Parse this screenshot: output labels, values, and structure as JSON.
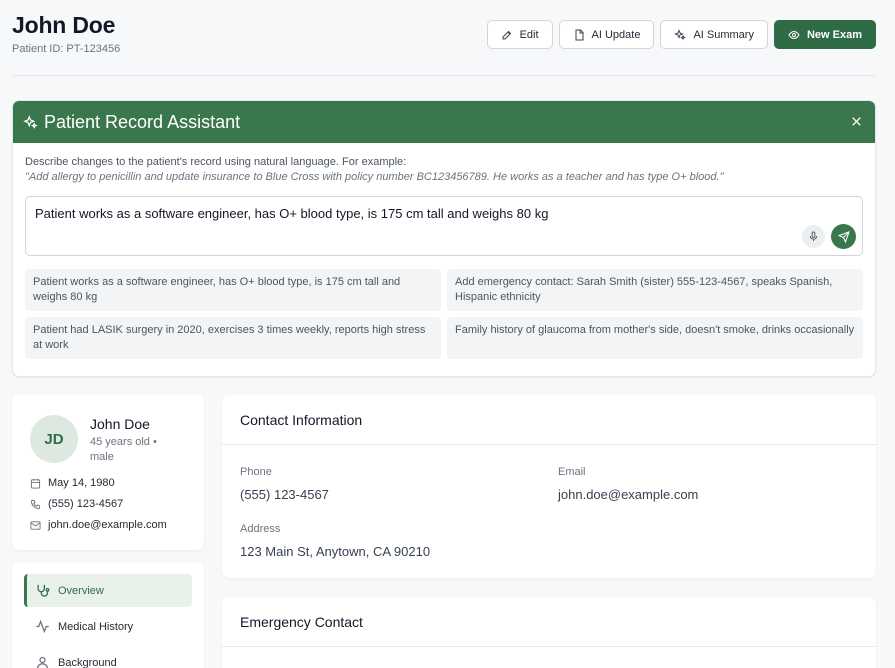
{
  "header": {
    "name": "John Doe",
    "patient_id": "Patient ID: PT-123456",
    "actions": {
      "edit": "Edit",
      "ai_update": "AI Update",
      "ai_summary": "AI Summary",
      "new_exam": "New Exam"
    }
  },
  "assistant": {
    "title": "Patient Record Assistant",
    "hint": "Describe changes to the patient's record using natural language. For example:",
    "example": "\"Add allergy to penicillin and update insurance to Blue Cross with policy number BC123456789. He works as a teacher and has type O+ blood.\"",
    "input_value": "Patient works as a software engineer, has O+ blood type, is 175 cm tall and weighs 80 kg",
    "suggestions": [
      "Patient works as a software engineer, has O+ blood type, is 175 cm tall and weighs 80 kg",
      "Add emergency contact: Sarah Smith (sister) 555-123-4567, speaks Spanish, Hispanic ethnicity",
      "Patient had LASIK surgery in 2020, exercises 3 times weekly, reports high stress at work",
      "Family history of glaucoma from mother's side, doesn't smoke, drinks occasionally"
    ]
  },
  "profile": {
    "initials": "JD",
    "name": "John Doe",
    "meta": "45 years old • male",
    "dob": "May 14, 1980",
    "phone": "(555) 123-4567",
    "email": "john.doe@example.com"
  },
  "nav": {
    "items": [
      "Overview",
      "Medical History",
      "Background"
    ]
  },
  "contact": {
    "title": "Contact Information",
    "phone_label": "Phone",
    "phone": "(555) 123-4567",
    "email_label": "Email",
    "email": "john.doe@example.com",
    "address_label": "Address",
    "address": "123 Main St, Anytown, CA 90210"
  },
  "emergency": {
    "title": "Emergency Contact"
  },
  "colors": {
    "brand": "#3a774d",
    "brand_dark": "#2f6b45"
  }
}
